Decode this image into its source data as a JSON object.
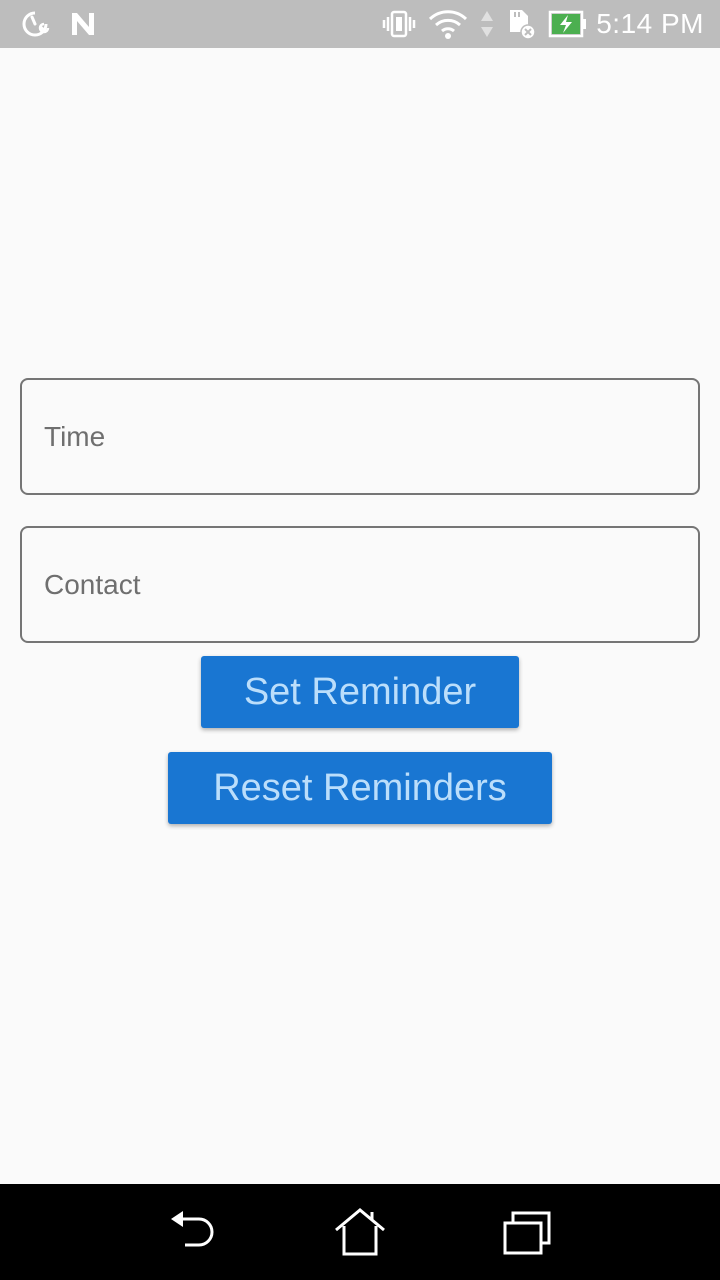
{
  "status_bar": {
    "time": "5:14 PM",
    "icons": [
      "speedometer-wrench-icon",
      "n-logo-icon",
      "vibrate-icon",
      "wifi-icon",
      "data-arrows-icon",
      "sd-card-x-icon",
      "battery-charging-icon"
    ],
    "battery_color": "#4caf50"
  },
  "form": {
    "time_placeholder": "Time",
    "time_value": "",
    "contact_placeholder": "Contact",
    "contact_value": ""
  },
  "buttons": {
    "set_label": "Set Reminder",
    "reset_label": "Reset Reminders",
    "accent": "#1976d2",
    "text_color": "#bbdefb"
  },
  "nav_bar": {
    "icons": [
      "back-icon",
      "home-icon",
      "recents-icon"
    ]
  }
}
